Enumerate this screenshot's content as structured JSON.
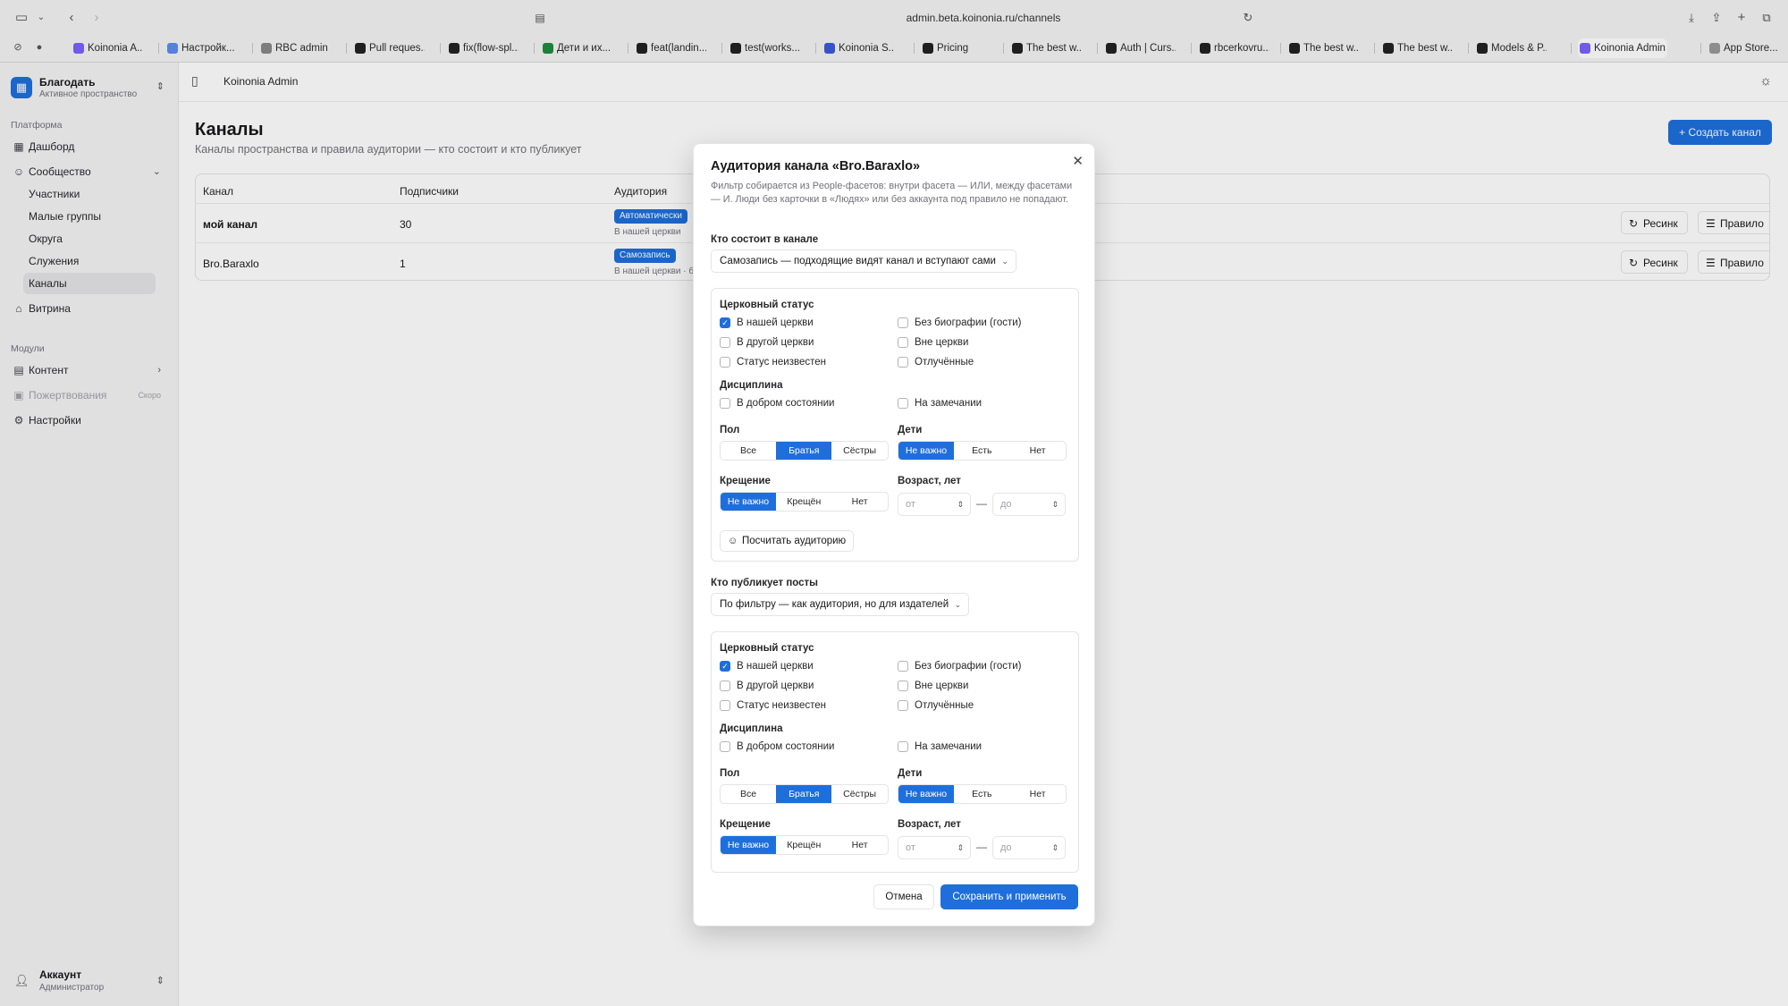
{
  "browser": {
    "url": "admin.beta.koinonia.ru/channels",
    "tabs": [
      {
        "label": "Koinonia A...",
        "color": "#7b61ff"
      },
      {
        "label": "Настройк...",
        "color": "#5b8def"
      },
      {
        "label": "RBC admin",
        "color": "#888888"
      },
      {
        "label": "Pull reques...",
        "color": "#222222"
      },
      {
        "label": "fix(flow-spl...",
        "color": "#222222"
      },
      {
        "label": "Дети и их...",
        "color": "#1e8e3e"
      },
      {
        "label": "feat(landin...",
        "color": "#222222"
      },
      {
        "label": "test(works...",
        "color": "#222222"
      },
      {
        "label": "Koinonia S...",
        "color": "#3b5bdb"
      },
      {
        "label": "Pricing",
        "color": "#222222"
      },
      {
        "label": "The best w...",
        "color": "#222222"
      },
      {
        "label": "Auth | Curs...",
        "color": "#222222"
      },
      {
        "label": "rbcerkovru...",
        "color": "#222222"
      },
      {
        "label": "The best w...",
        "color": "#222222"
      },
      {
        "label": "The best w...",
        "color": "#222222"
      },
      {
        "label": "Models & P...",
        "color": "#222222"
      },
      {
        "label": "Koinonia Admin",
        "color": "#7b61ff"
      },
      {
        "label": "App Store...",
        "color": "#999999"
      }
    ]
  },
  "sidebar": {
    "workspace_name": "Благодать",
    "workspace_sub": "Активное пространство",
    "platform_label": "Платформа",
    "dashboard": "Дашборд",
    "community": "Сообщество",
    "community_items": [
      "Участники",
      "Малые группы",
      "Округа",
      "Служения",
      "Каналы"
    ],
    "showcase": "Витрина",
    "modules_label": "Модули",
    "content": "Контент",
    "donations": "Пожертвования",
    "soon": "Скоро",
    "settings": "Настройки",
    "account_name": "Аккаунт",
    "account_role": "Администратор"
  },
  "header": {
    "breadcrumb": "Koinonia Admin"
  },
  "page": {
    "title": "Каналы",
    "subtitle": "Каналы пространства и правила аудитории — кто состоит и кто публикует",
    "create_button": "Создать канал",
    "columns": [
      "Канал",
      "Подписчики",
      "Аудитория"
    ],
    "rows": [
      {
        "name": "мой канал",
        "subscribers": "30",
        "badge": "Автоматически",
        "note": "В нашей церкви"
      },
      {
        "name": "Bro.Baraxlo",
        "subscribers": "1",
        "badge": "Самозапись",
        "note": "В нашей церкви · б"
      }
    ],
    "resync": "Ресинк",
    "rule": "Правило"
  },
  "modal": {
    "title": "Аудитория канала «Bro.Baraxlo»",
    "description": "Фильтр собирается из People-фасетов: внутри фасета — ИЛИ, между фасетами — И. Люди без карточки в «Людях» или без аккаунта под правило не попадают.",
    "members_label": "Кто состоит в канале",
    "members_mode": "Самозапись — подходящие видят канал и вступают сами",
    "publishers_label": "Кто публикует посты",
    "publishers_mode": "По фильтру — как аудитория, но для издателей",
    "count_button": "Посчитать аудиторию",
    "cancel": "Отмена",
    "save": "Сохранить и применить",
    "labels": {
      "church_status": "Церковный статус",
      "discipline": "Дисциплина",
      "gender": "Пол",
      "children": "Дети",
      "baptism": "Крещение",
      "age": "Возраст, лет"
    },
    "church_status_options": [
      "В нашей церкви",
      "Без биографии (гости)",
      "В другой церкви",
      "Вне церкви",
      "Статус неизвестен",
      "Отлучённые"
    ],
    "discipline_options": [
      "В добром состоянии",
      "На замечании"
    ],
    "gender_options": [
      "Все",
      "Братья",
      "Сёстры"
    ],
    "children_options": [
      "Не важно",
      "Есть",
      "Нет"
    ],
    "baptism_options": [
      "Не важно",
      "Крещён",
      "Нет"
    ],
    "age_from": "от",
    "age_to": "до",
    "dash": "—",
    "filters": [
      {
        "church_checked": [
          true,
          false,
          false,
          false,
          false,
          false
        ],
        "discipline_checked": [
          false,
          false
        ],
        "gender": 1,
        "children": 0,
        "baptism": 0
      },
      {
        "church_checked": [
          true,
          false,
          false,
          false,
          false,
          false
        ],
        "discipline_checked": [
          false,
          false
        ],
        "gender": 1,
        "children": 0,
        "baptism": 0
      }
    ]
  }
}
